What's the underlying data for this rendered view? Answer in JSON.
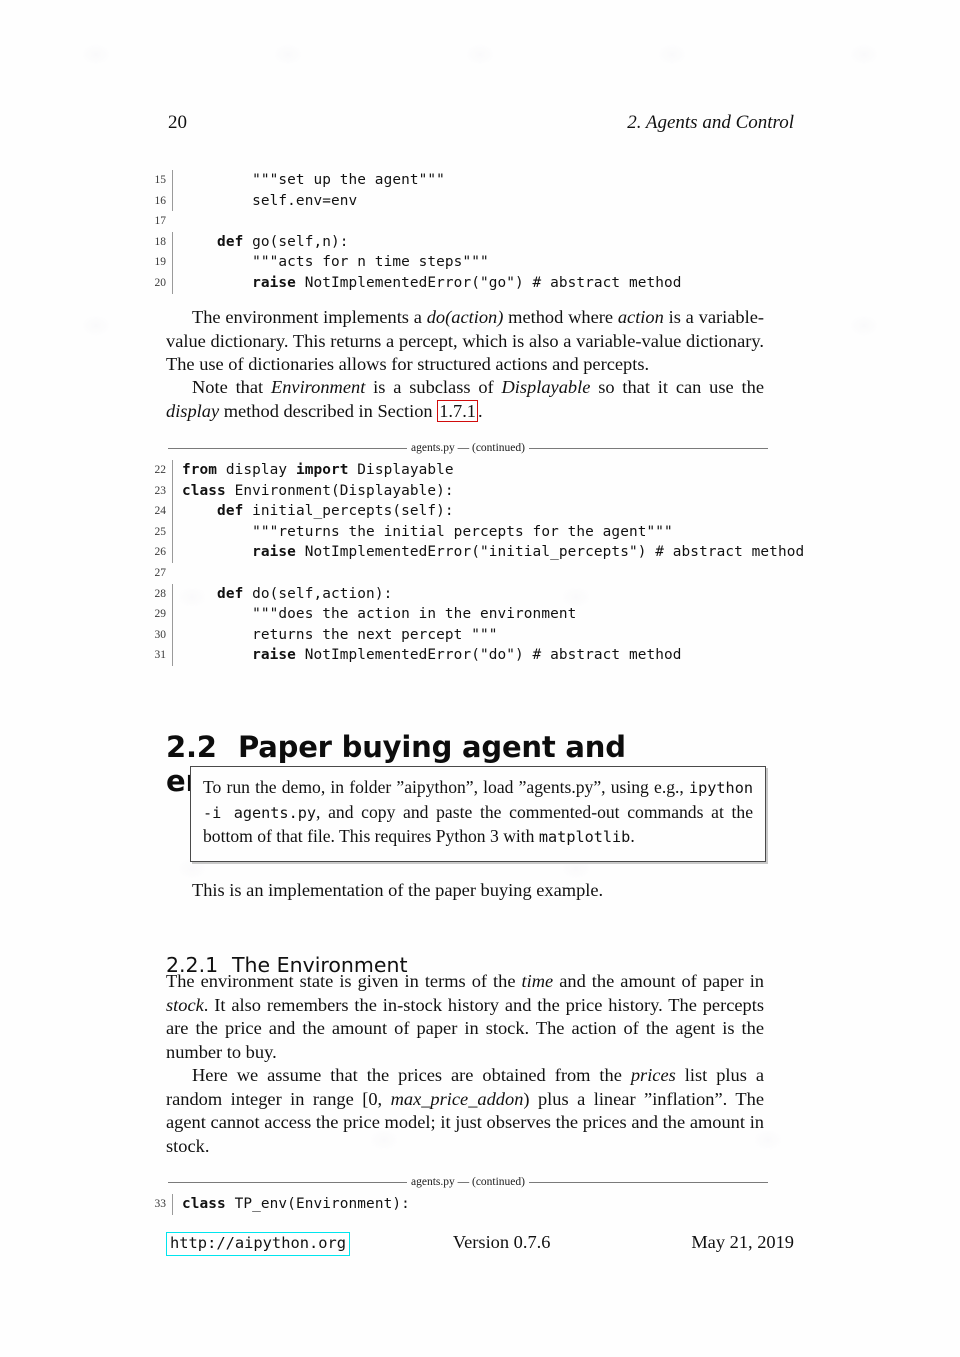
{
  "page": {
    "folio": "20",
    "running_head": "2.  Agents and Control"
  },
  "listing_top": {
    "lines": [
      {
        "num": "15",
        "text": "        \"\"\"set up the agent\"\"\""
      },
      {
        "num": "16",
        "text": "        self.env=env"
      },
      {
        "num": "17",
        "text": ""
      },
      {
        "num": "18",
        "text": "    def go(self,n):",
        "bold_prefix": "    def",
        "rest": " go(self,n):"
      },
      {
        "num": "19",
        "text": "        \"\"\"acts for n time steps\"\"\""
      },
      {
        "num": "20",
        "text": "        raise NotImplementedError(\"go\") # abstract method",
        "bold_prefix": "        raise",
        "rest": " NotImplementedError(\"go\") # abstract method"
      }
    ]
  },
  "paragraphs": {
    "p1_part1": "The environment implements a ",
    "p1_do": "do(action)",
    "p1_part2": " method where ",
    "p1_action": "action",
    "p1_part3": " is a variable-value dictionary. This returns a percept, which is also a variable-value dictionary. The use of dictionaries allows for structured actions and percepts.",
    "p2_part1": "Note that ",
    "p2_env": "Environment",
    "p2_part2": " is a subclass of ",
    "p2_disp": "Displayable",
    "p2_part3": " so that it can use the ",
    "p2_display": "display",
    "p2_part4": " method described in Section ",
    "p2_ref": "1.7.1",
    "p2_part5": ".",
    "p3": "This is an implementation of the paper buying example.",
    "p4_part1": "The environment state is given in terms of the ",
    "p4_time": "time",
    "p4_part2": " and the amount of paper in ",
    "p4_stock": "stock",
    "p4_part3": ". It also remembers the in-stock history and the price history. The percepts are the price and the amount of paper in stock. The action of the agent is the number to buy.",
    "p5_part1": "Here we assume that the prices are obtained from the ",
    "p5_prices": "prices",
    "p5_part2": " list plus a random integer in range [0, ",
    "p5_max": "max_price_addon",
    "p5_part3": ") plus a linear ”inflation”. The agent cannot access the price model; it just observes the prices and the amount in stock."
  },
  "code_caption": "agents.py — (continued)",
  "listing_mid": {
    "caption": "agents.py — (continued)",
    "lines": [
      {
        "num": "22",
        "bold": "from",
        "mid": " display ",
        "bold2": "import",
        "tail": " Displayable"
      },
      {
        "num": "23",
        "bold": "class",
        "mid": " Environment(Displayable):",
        "bold2": "",
        "tail": ""
      },
      {
        "num": "24",
        "bold": "    def",
        "mid": " initial_percepts(self):",
        "bold2": "",
        "tail": ""
      },
      {
        "num": "25",
        "bold": "",
        "mid": "        \"\"\"returns the initial percepts for the agent\"\"\"",
        "bold2": "",
        "tail": ""
      },
      {
        "num": "26",
        "bold": "        raise",
        "mid": " NotImplementedError(\"initial_percepts\") # abstract method",
        "bold2": "",
        "tail": ""
      },
      {
        "num": "27",
        "bold": "",
        "mid": "",
        "bold2": "",
        "tail": ""
      },
      {
        "num": "28",
        "bold": "    def",
        "mid": " do(self,action):",
        "bold2": "",
        "tail": ""
      },
      {
        "num": "29",
        "bold": "",
        "mid": "        \"\"\"does the action in the environment",
        "bold2": "",
        "tail": ""
      },
      {
        "num": "30",
        "bold": "",
        "mid": "        returns the next percept \"\"\"",
        "bold2": "",
        "tail": ""
      },
      {
        "num": "31",
        "bold": "        raise",
        "mid": " NotImplementedError(\"do\") # abstract method",
        "bold2": "",
        "tail": ""
      }
    ]
  },
  "listing_bottom": {
    "caption": "agents.py — (continued)",
    "lines": [
      {
        "num": "33",
        "bold": "class",
        "mid": " TP_env(Environment):",
        "bold2": "",
        "tail": ""
      }
    ]
  },
  "heading_section": {
    "number": "2.2",
    "title": "Paper buying agent and environment"
  },
  "heading_subsection": {
    "number": "2.2.1",
    "title": "The Environment"
  },
  "notebox": {
    "t1": "To run the demo, in folder ”aipython”, load ”agents.py”, using e.g., ",
    "code1": "ipython -i agents.py",
    "t2": ", and copy and paste the commented-out commands at the bottom of that file.  This requires Python 3 with ",
    "code2": "matplotlib",
    "t3": "."
  },
  "footer": {
    "url": "http://aipython.org",
    "version": "Version 0.7.6",
    "date": "May 21, 2019"
  },
  "colors": {
    "link_box_red": "#d10b0b",
    "link_box_cyan": "#00e5ee",
    "text": "#111111",
    "rule_gray": "#7a7a7a"
  }
}
